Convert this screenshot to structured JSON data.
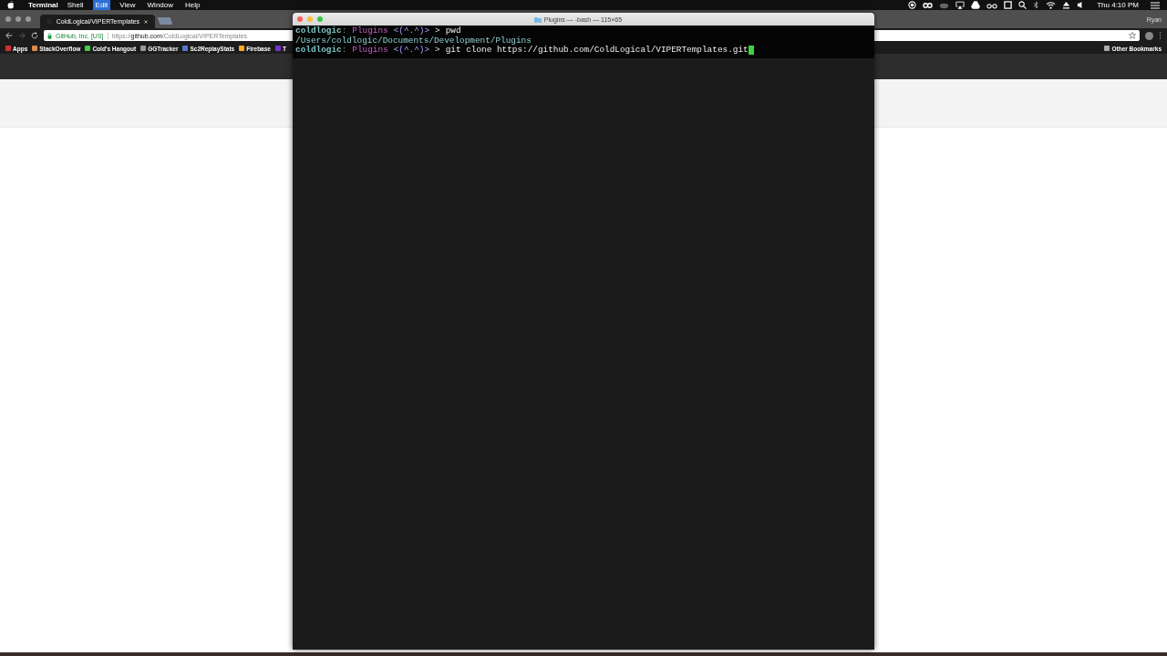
{
  "menu_bar": {
    "app": "Terminal",
    "menus": [
      {
        "label": "Shell",
        "selected": false
      },
      {
        "label": "Edit",
        "selected": true
      },
      {
        "label": "View",
        "selected": false
      },
      {
        "label": "Window",
        "selected": false
      },
      {
        "label": "Help",
        "selected": false
      }
    ],
    "clock": "Thu 4:10 PM"
  },
  "browser": {
    "tab": {
      "title": "ColdLogical/VIPERTemplates"
    },
    "profile": "Ryan",
    "address": {
      "identity": "GitHub, Inc. [US]",
      "url_prefix": "https://",
      "url_host": "github.com",
      "url_path": "/ColdLogical/VIPERTemplates"
    },
    "bookmarks": [
      "Apps",
      "StackOverflow",
      "Cold's Hangout",
      "GGTracker",
      "Sc2ReplayStats",
      "Firebase",
      "T"
    ],
    "other_bookmarks": "Other Bookmarks"
  },
  "terminal": {
    "title": "Plugins — -bash — 115×65",
    "lines": [
      {
        "kind": "prompt",
        "user": "coldlogic",
        "sep": ":",
        "dir": "Plugins",
        "face": "<(^.^)>",
        "arrow": ">",
        "command": "pwd",
        "cursor": false
      },
      {
        "kind": "output",
        "text": "/Users/coldlogic/Documents/Development/Plugins"
      },
      {
        "kind": "prompt",
        "user": "coldlogic",
        "sep": ":",
        "dir": "Plugins",
        "face": "<(^.^)>",
        "arrow": ">",
        "command": "git clone https://github.com/ColdLogical/VIPERTemplates.git",
        "cursor": true
      }
    ]
  }
}
